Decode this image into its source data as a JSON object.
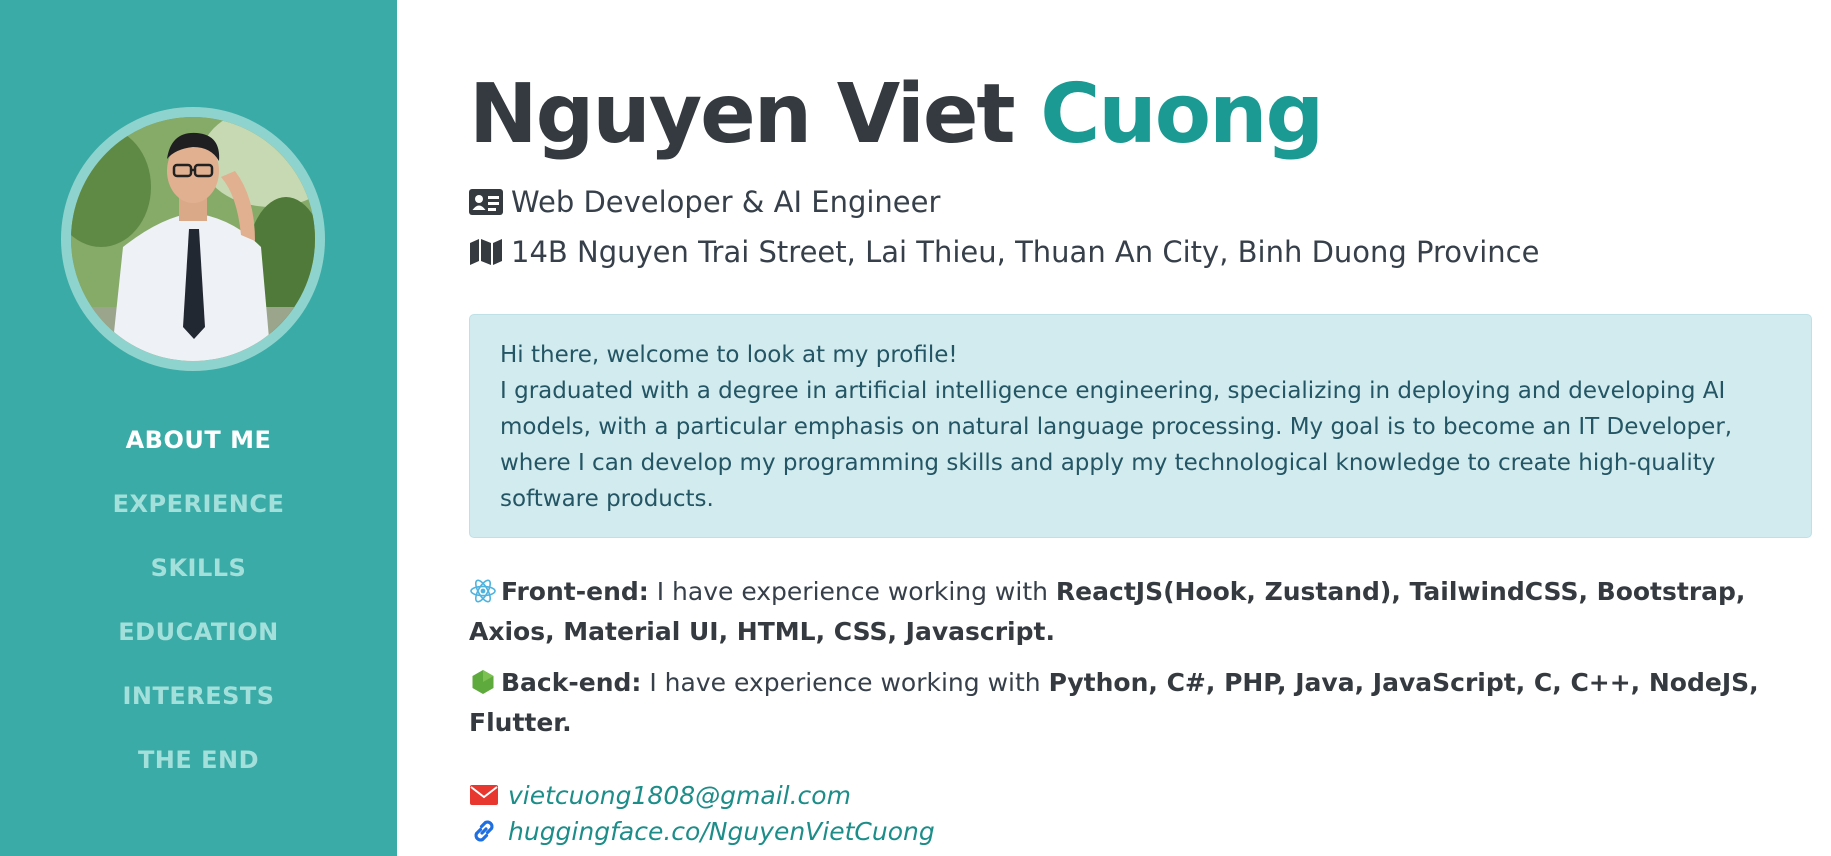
{
  "profile": {
    "first_name": "Nguyen Viet",
    "last_name": "Cuong",
    "title": "Web Developer & AI Engineer",
    "address": "14B Nguyen Trai Street, Lai Thieu, Thuan An City, Binh Duong Province"
  },
  "nav": {
    "items": [
      {
        "label": "ABOUT ME",
        "active": true
      },
      {
        "label": "EXPERIENCE"
      },
      {
        "label": "SKILLS"
      },
      {
        "label": "EDUCATION"
      },
      {
        "label": "INTERESTS"
      },
      {
        "label": "THE END"
      }
    ]
  },
  "intro": {
    "greeting": "Hi there, welcome to look at my profile!",
    "body": "I graduated with a degree in artificial intelligence engineering, specializing in deploying and developing AI models, with a particular emphasis on natural language processing. My goal is to become an IT Developer, where I can develop my programming skills and apply my technological knowledge to create high-quality software products."
  },
  "skills": {
    "frontend": {
      "label": "Front-end:",
      "text": " I have experience working with ",
      "tech": "ReactJS(Hook, Zustand), TailwindCSS, Bootstrap, Axios, Material UI, HTML, CSS, Javascript."
    },
    "backend": {
      "label": "Back-end:",
      "text": " I have experience working with ",
      "tech": "Python, C#, PHP, Java, JavaScript, C, C++, NodeJS, Flutter."
    }
  },
  "contact": {
    "email": "vietcuong1808@gmail.com",
    "link": "huggingface.co/NguyenVietCuong"
  },
  "icons": {
    "title": "id-card-icon",
    "address": "map-icon",
    "frontend": "react-icon",
    "backend": "nodejs-icon",
    "email": "envelope-icon",
    "link": "link-icon"
  },
  "colors": {
    "sidebar": "#3aaba6",
    "accent": "#1a9a93",
    "nav_active": "#ffffff",
    "nav_inactive": "#a4e0db",
    "intro_bg": "#d1ebee",
    "email_icon": "#e8372e",
    "link_icon": "#1f6fe0"
  }
}
